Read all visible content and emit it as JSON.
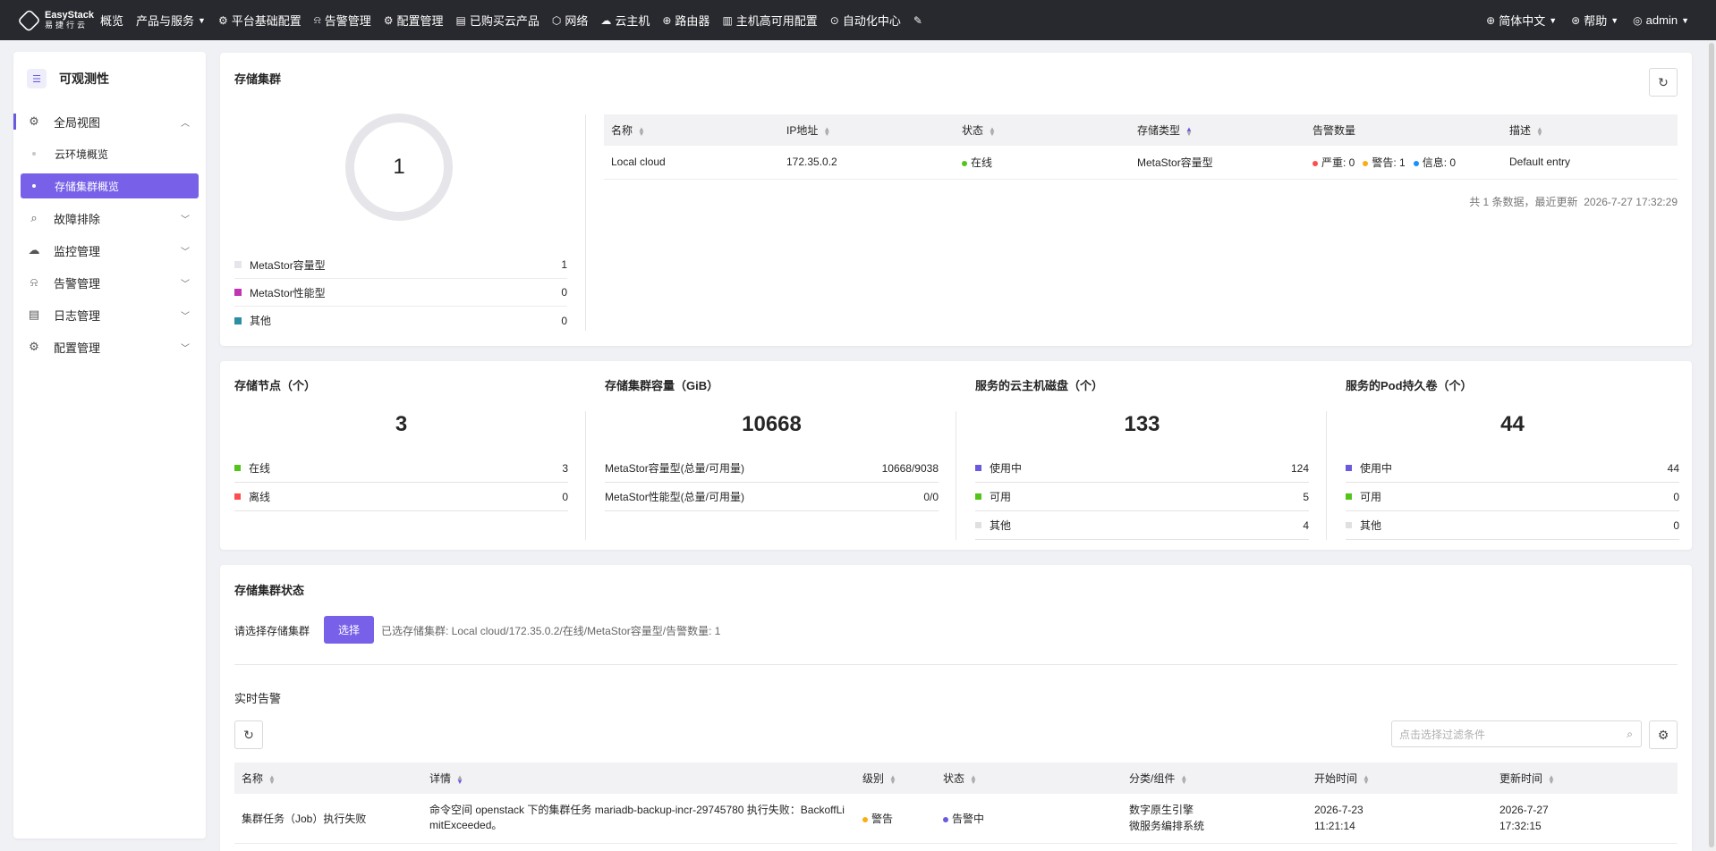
{
  "colors": {
    "accent": "#6a5ae0",
    "primary_button": "#7861e8",
    "nav_bg": "#28292e",
    "online": "#52c41a",
    "offline": "#ff4d4f",
    "warning": "#faad14",
    "info": "#1890ff"
  },
  "topnav": {
    "logo_line1": "EasyStack",
    "logo_line2": "易捷行云",
    "items": [
      {
        "label": "概览",
        "icon": ""
      },
      {
        "label": "产品与服务",
        "icon": "",
        "dropdown": true
      },
      {
        "label": "平台基础配置",
        "icon": "gear-icon"
      },
      {
        "label": "告警管理",
        "icon": "alarm-icon"
      },
      {
        "label": "配置管理",
        "icon": "gear-icon"
      },
      {
        "label": "已购买云产品",
        "icon": "list-icon"
      },
      {
        "label": "网络",
        "icon": "network-icon"
      },
      {
        "label": "云主机",
        "icon": "cloud-icon"
      },
      {
        "label": "路由器",
        "icon": "router-icon"
      },
      {
        "label": "主机高可用配置",
        "icon": "host-icon"
      },
      {
        "label": "自动化中心",
        "icon": "automation-icon"
      }
    ],
    "right": {
      "language": "简体中文",
      "help": "帮助",
      "user": "admin"
    }
  },
  "sidebar": {
    "title": "可观测性",
    "global_view": "全局视图",
    "sub_items": [
      "云环境概览",
      "存储集群概览"
    ],
    "items": [
      "故障排除",
      "监控管理",
      "告警管理",
      "日志管理",
      "配置管理"
    ]
  },
  "cluster_card": {
    "title": "存储集群",
    "donut_total": "1",
    "legend": [
      {
        "label": "MetaStor容量型",
        "value": "1",
        "color": "#e6e6ea"
      },
      {
        "label": "MetaStor性能型",
        "value": "0",
        "color": "#c135b4"
      },
      {
        "label": "其他",
        "value": "0",
        "color": "#2b8fa4"
      }
    ],
    "table": {
      "headers": [
        "名称",
        "IP地址",
        "状态",
        "存储类型",
        "告警数量",
        "描述"
      ],
      "row": {
        "name": "Local cloud",
        "ip": "172.35.0.2",
        "status": "在线",
        "type": "MetaStor容量型",
        "alert_critical": "严重: 0",
        "alert_warning": "警告: 1",
        "alert_info": "信息: 0",
        "desc": "Default entry"
      },
      "footer_count": "共 1 条数据，最近更新",
      "footer_time": "2026-7-27 17:32:29"
    }
  },
  "stats": [
    {
      "title": "存储节点（个）",
      "big": "3",
      "rows": [
        {
          "label": "在线",
          "value": "3",
          "color": "#52c41a"
        },
        {
          "label": "离线",
          "value": "0",
          "color": "#ff4d4f"
        }
      ]
    },
    {
      "title": "存储集群容量（GiB）",
      "big": "10668",
      "rows": [
        {
          "label": "MetaStor容量型(总量/可用量)",
          "value": "10668/9038"
        },
        {
          "label": "MetaStor性能型(总量/可用量)",
          "value": "0/0"
        }
      ]
    },
    {
      "title": "服务的云主机磁盘（个）",
      "big": "133",
      "rows": [
        {
          "label": "使用中",
          "value": "124",
          "color": "#6a5ae0"
        },
        {
          "label": "可用",
          "value": "5",
          "color": "#52c41a"
        },
        {
          "label": "其他",
          "value": "4",
          "color": "#e0e0e0"
        }
      ]
    },
    {
      "title": "服务的Pod持久卷（个）",
      "big": "44",
      "rows": [
        {
          "label": "使用中",
          "value": "44",
          "color": "#6a5ae0"
        },
        {
          "label": "可用",
          "value": "0",
          "color": "#52c41a"
        },
        {
          "label": "其他",
          "value": "0",
          "color": "#e0e0e0"
        }
      ]
    }
  ],
  "status_card": {
    "title": "存储集群状态",
    "select_label": "请选择存储集群",
    "select_button": "选择",
    "selected_info": "已选存储集群:  Local cloud/172.35.0.2/在线/MetaStor容量型/告警数量: 1",
    "realtime_title": "实时告警",
    "search_placeholder": "点击选择过滤条件",
    "table": {
      "headers": [
        "名称",
        "详情",
        "级别",
        "状态",
        "分类/组件",
        "开始时间",
        "更新时间"
      ],
      "row": {
        "name": "集群任务（Job）执行失败",
        "detail": "命令空间 openstack 下的集群任务 mariadb-backup-incr-29745780 执行失败：BackoffLimitExceeded。",
        "level": "警告",
        "status": "告警中",
        "category_1": "数字原生引擎",
        "category_2": "微服务编排系统",
        "start_1": "2026-7-23",
        "start_2": "11:21:14",
        "update_1": "2026-7-27",
        "update_2": "17:32:15"
      }
    }
  }
}
